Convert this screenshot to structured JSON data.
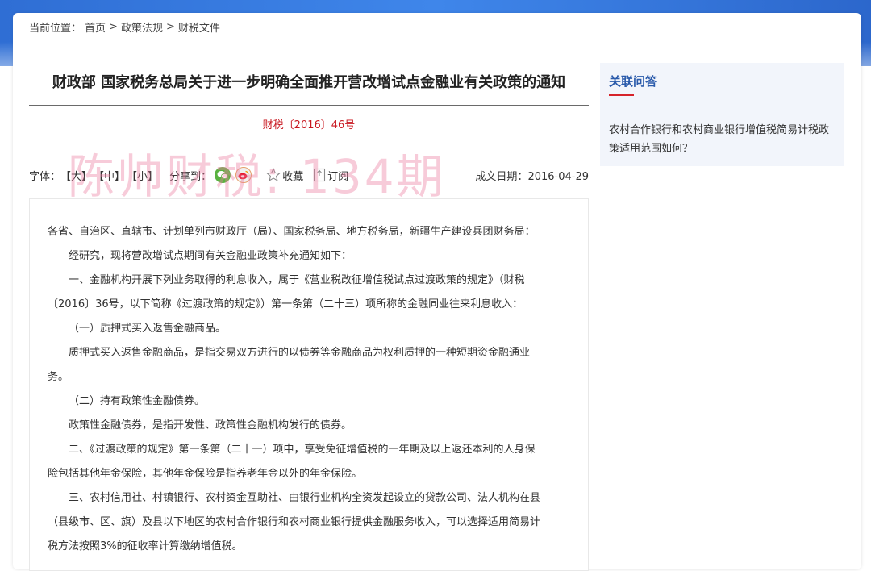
{
  "breadcrumb": {
    "prefix": "当前位置：",
    "items": [
      "首页",
      "政策法规",
      "财税文件"
    ],
    "separator": ">"
  },
  "article": {
    "title": "财政部 国家税务总局关于进一步明确全面推开营改增试点金融业有关政策的通知",
    "doc_number": "财税〔2016〕46号",
    "watermark": "陈帅财税: 134期"
  },
  "toolbar": {
    "font_label": "字体：",
    "font_large": "【大】",
    "font_medium": "【中】",
    "font_small": "【小】",
    "share_label": "分享到：",
    "favorite_label": "收藏",
    "subscribe_label": "订阅",
    "date_label": "成文日期：",
    "date_value": "2016-04-29"
  },
  "body": {
    "p1": "各省、自治区、直辖市、计划单列市财政厅（局）、国家税务局、地方税务局，新疆生产建设兵团财务局：",
    "p2": "经研究，现将营改增试点期间有关金融业政策补充通知如下：",
    "p3a": "一、金融机构开展下列业务取得的利息收入，属于《营业税改征增值税试点过渡政策的规定》（财税",
    "p3b": "〔2016〕36号，以下简称《过渡政策的规定》）第一条第（二十三）项所称的金融同业往来利息收入：",
    "p4": "（一）质押式买入返售金融商品。",
    "p5a": "质押式买入返售金融商品，是指交易双方进行的以债券等金融商品为权利质押的一种短期资金融通业",
    "p5b": "务。",
    "p6": "（二）持有政策性金融债券。",
    "p7": "政策性金融债券，是指开发性、政策性金融机构发行的债券。",
    "p8a": "二、《过渡政策的规定》第一条第（二十一）项中，享受免征增值税的一年期及以上返还本利的人身保",
    "p8b": "险包括其他年金保险，其他年金保险是指养老年金以外的年金保险。",
    "p9a": "三、农村信用社、村镇银行、农村资金互助社、由银行业机构全资发起设立的贷款公司、法人机构在县",
    "p9b": "（县级市、区、旗）及县以下地区的农村合作银行和农村商业银行提供金融服务收入，可以选择适用简易计",
    "p9c": "税方法按照3%的征收率计算缴纳增值税。"
  },
  "sidebar": {
    "title": "关联问答",
    "link": "农村合作银行和农村商业银行增值税简易计税政策适用范围如何？"
  },
  "colors": {
    "header_blue": "#3f86ea",
    "doc_number_red": "#c8161e",
    "sidebar_title_blue": "#2b5bab",
    "accent_red": "#d6232a",
    "wechat_green": "#59b240"
  }
}
